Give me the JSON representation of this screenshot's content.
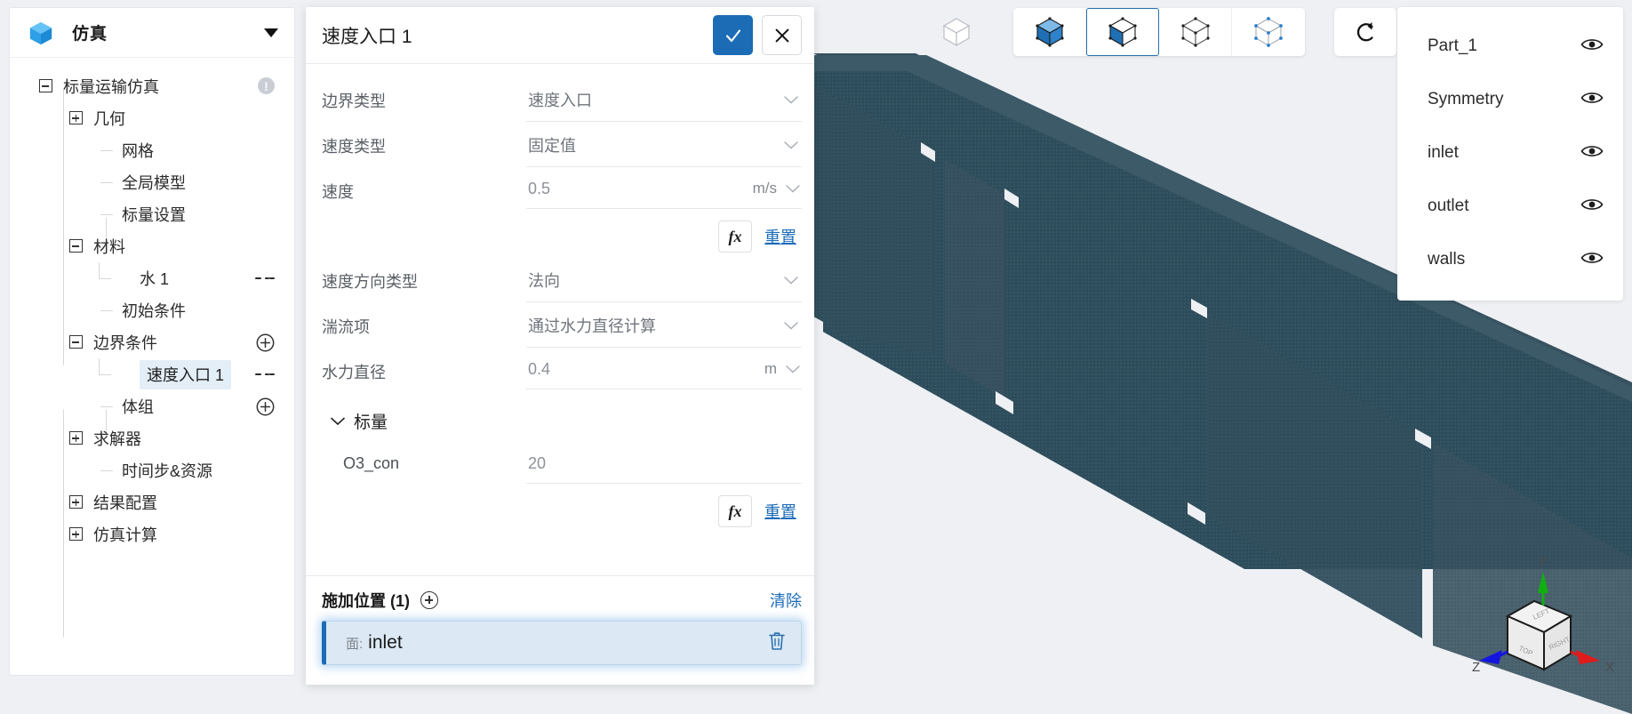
{
  "app": {
    "title": "仿真",
    "logo_icon": "blue-cube-icon",
    "caret_icon": "chevron-down-icon"
  },
  "sidebar": {
    "tree": [
      {
        "label": "标量运输仿真",
        "level": 0,
        "toggle": "minus",
        "badge": "!"
      },
      {
        "label": "几何",
        "level": 1,
        "toggle": "plus"
      },
      {
        "label": "网格",
        "level": 2,
        "toggle": "none"
      },
      {
        "label": "全局模型",
        "level": 2,
        "toggle": "none"
      },
      {
        "label": "标量设置",
        "level": 2,
        "toggle": "none"
      },
      {
        "label": "材料",
        "level": 1,
        "toggle": "minus"
      },
      {
        "label": "水 1",
        "level": 3,
        "toggle": "none",
        "icon": "menu-icon"
      },
      {
        "label": "初始条件",
        "level": 2,
        "toggle": "none"
      },
      {
        "label": "边界条件",
        "level": 1,
        "toggle": "minus",
        "icon": "plus-circle-icon"
      },
      {
        "label": "速度入口 1",
        "level": 3,
        "toggle": "none",
        "icon": "menu-icon",
        "selected": true
      },
      {
        "label": "体组",
        "level": 2,
        "toggle": "none",
        "icon": "plus-circle-icon"
      },
      {
        "label": "求解器",
        "level": 1,
        "toggle": "plus"
      },
      {
        "label": "时间步&资源",
        "level": 2,
        "toggle": "none"
      },
      {
        "label": "结果配置",
        "level": 1,
        "toggle": "plus"
      },
      {
        "label": "仿真计算",
        "level": 1,
        "toggle": "plus"
      }
    ]
  },
  "dialog": {
    "title": "速度入口 1",
    "confirm_icon": "check-icon",
    "cancel_icon": "close-icon",
    "fields": [
      {
        "label": "边界类型",
        "value": "速度入口",
        "type": "select"
      },
      {
        "label": "速度类型",
        "value": "固定值",
        "type": "select"
      },
      {
        "label": "速度",
        "value": "0.5",
        "type": "input",
        "unit": "m/s"
      }
    ],
    "fx_row_1": {
      "fx_label": "fx",
      "reset_label": "重置"
    },
    "fields2": [
      {
        "label": "速度方向类型",
        "value": "法向",
        "type": "select"
      },
      {
        "label": "湍流项",
        "value": "通过水力直径计算",
        "type": "select"
      },
      {
        "label": "水力直径",
        "value": "0.4",
        "type": "input",
        "unit": "m"
      }
    ],
    "scalar_group": {
      "label": "标量",
      "expanded_icon": "chevron-down-icon",
      "rows": [
        {
          "label": "O3_con",
          "value": "20"
        }
      ]
    },
    "fx_row_2": {
      "fx_label": "fx",
      "reset_label": "重置"
    },
    "footer": {
      "title": "施加位置 (1)",
      "add_icon": "plus-circle-icon",
      "clear_label": "清除",
      "selection": {
        "prefix": "面:",
        "name": "inlet",
        "delete_icon": "trash-icon"
      }
    }
  },
  "toolbar": {
    "ghost_icon": "wireframe-cube-icon",
    "buttons": [
      {
        "name": "shaded-cube-icon",
        "active": false
      },
      {
        "name": "shaded-edges-cube-icon",
        "active": true
      },
      {
        "name": "wireframe-points-cube-icon",
        "active": false
      },
      {
        "name": "points-cube-icon",
        "active": false
      }
    ],
    "reset_view_icon": "rotate-icon"
  },
  "parts_panel": {
    "items": [
      {
        "label": "Part_1",
        "visibility_icon": "eye-icon"
      },
      {
        "label": "Symmetry",
        "visibility_icon": "eye-icon"
      },
      {
        "label": "inlet",
        "visibility_icon": "eye-icon"
      },
      {
        "label": "outlet",
        "visibility_icon": "eye-icon"
      },
      {
        "label": "walls",
        "visibility_icon": "eye-icon"
      }
    ]
  },
  "viewport": {
    "background_color": "#eef0f4",
    "geometry_color": "#2e4d5c",
    "gizmo": {
      "axis_x": "X",
      "axis_y": "Y",
      "axis_z": "Z",
      "face_top": "TOP",
      "face_right": "RIGHT",
      "face_left": "LEFT",
      "x_color": "#e01b1b",
      "y_color": "#10b010",
      "z_color": "#1515e0"
    }
  },
  "colors": {
    "accent": "#1b6cb5",
    "link": "#1a6bb8",
    "selection_bg": "#dce9f4",
    "panel_bg": "#ffffff",
    "app_bg": "#eef0f4"
  }
}
